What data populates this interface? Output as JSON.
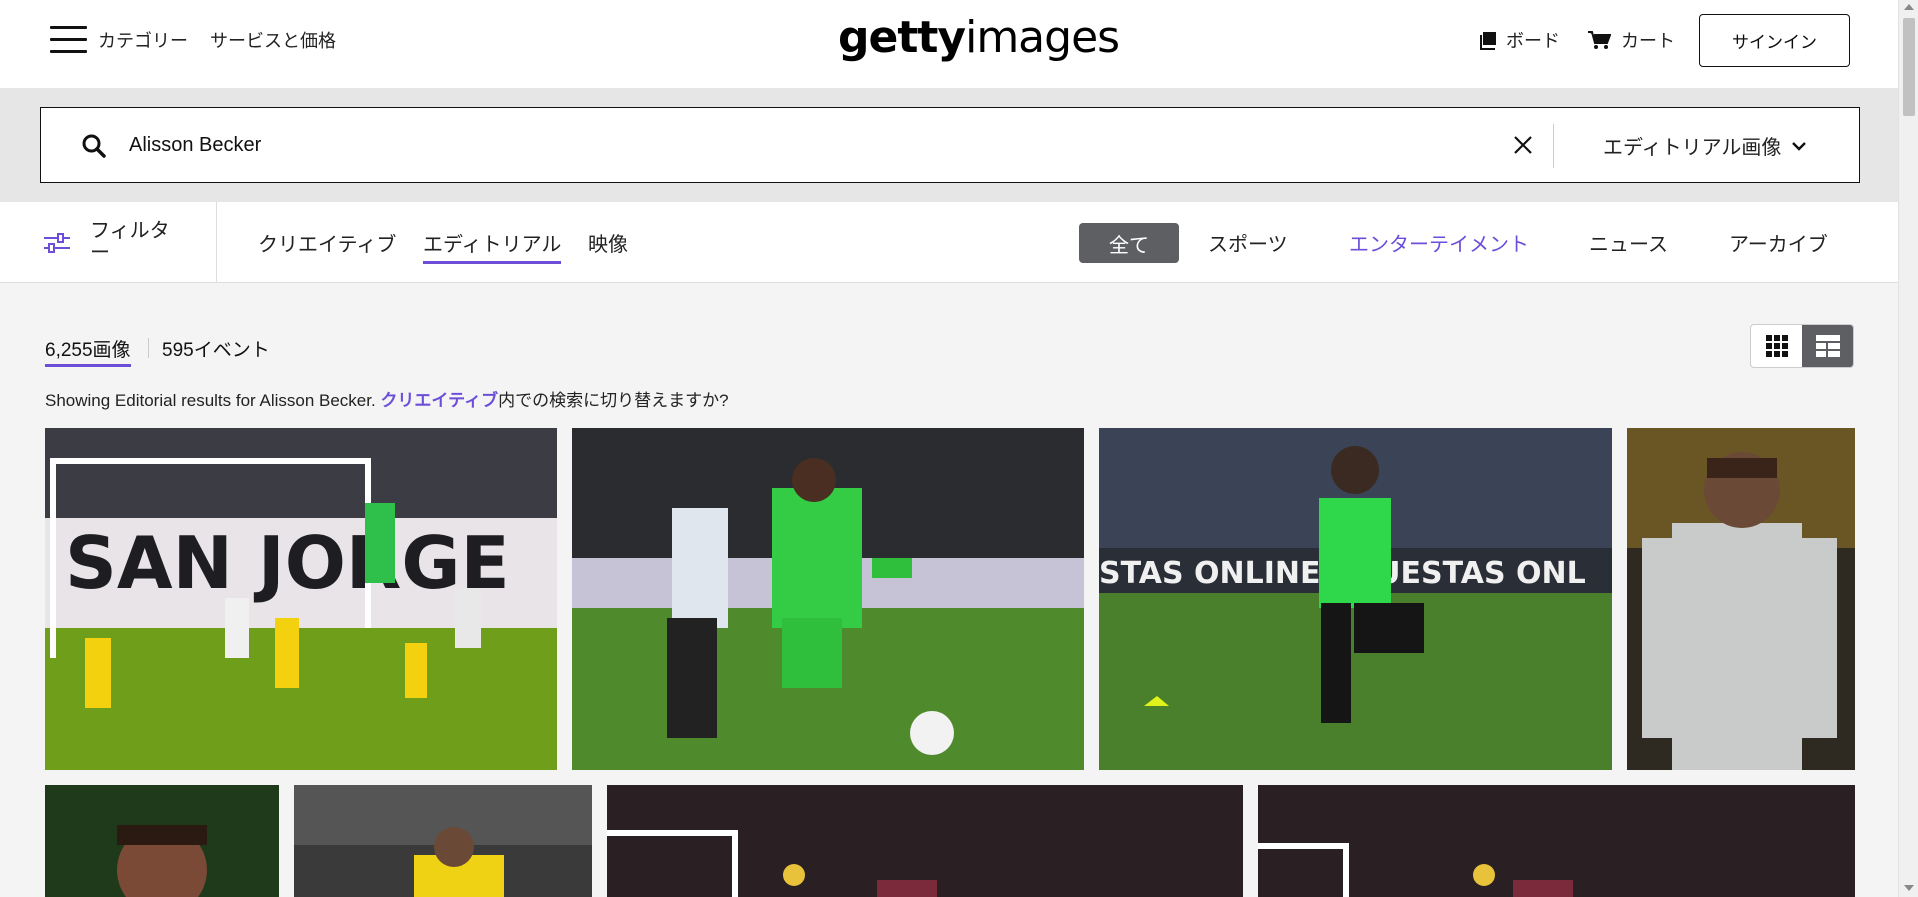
{
  "header": {
    "menu_label": "カテゴリー",
    "pricing_label": "サービスと価格",
    "logo_bold": "getty",
    "logo_light": "images",
    "board_label": "ボード",
    "cart_label": "カート",
    "signin_label": "サインイン"
  },
  "search": {
    "query": "Alisson Becker",
    "type_label": "エディトリアル画像"
  },
  "filterbar": {
    "filter_label": "フィルター",
    "tabs": [
      "クリエイティブ",
      "エディトリアル",
      "映像"
    ],
    "active_tab": "エディトリアル",
    "all_label": "全て",
    "categories": [
      "スポーツ",
      "エンターテイメント",
      "ニュース",
      "アーカイブ"
    ]
  },
  "results": {
    "images_count": "6,255画像",
    "events_count": "595イベント",
    "notice_prefix": "Showing Editorial results for Alisson Becker. ",
    "notice_link": "クリエイティブ",
    "notice_suffix": "内での検索に切り替えますか?"
  },
  "images": [
    {
      "subject": "brazil-vs-argentina-goalmouth"
    },
    {
      "subject": "goalkeeper-green-kit-kick"
    },
    {
      "subject": "goalkeeper-green-training-run"
    },
    {
      "subject": "goalkeeper-grey-kit-portrait"
    },
    {
      "subject": "goalkeeper-closeup-face"
    },
    {
      "subject": "goalkeeper-yellow-kit"
    },
    {
      "subject": "stadium-goal-wide"
    },
    {
      "subject": "stadium-goal-wide-2"
    }
  ],
  "colors": {
    "accent": "#6c4ed9",
    "chip": "#5d5f63",
    "search_band": "#e6e6e6"
  }
}
